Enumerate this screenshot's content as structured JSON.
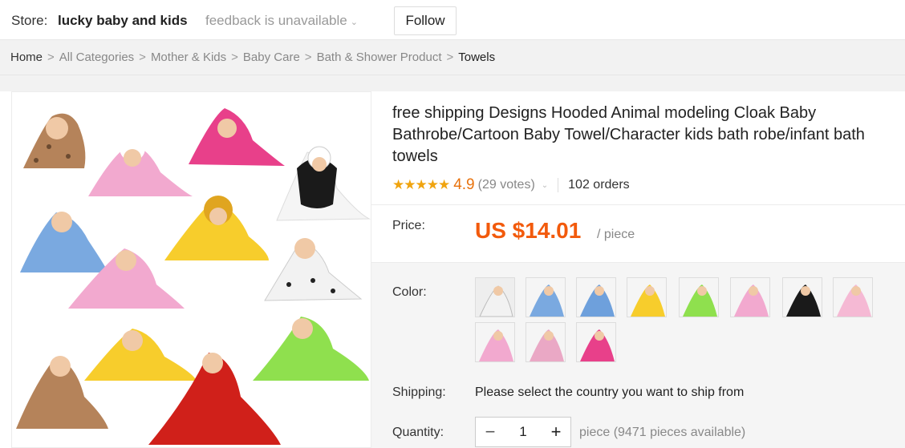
{
  "store": {
    "label": "Store:",
    "name": "lucky baby and kids",
    "feedback": "feedback is unavailable",
    "follow_label": "Follow"
  },
  "breadcrumb": {
    "items": [
      "Home",
      "All Categories",
      "Mother & Kids",
      "Baby Care",
      "Bath & Shower Product",
      "Towels"
    ],
    "separator": ">"
  },
  "product": {
    "title": "free shipping Designs Hooded Animal modeling Cloak Baby Bathrobe/Cartoon Baby Towel/Character kids bath robe/infant bath towels",
    "stars": "★★★★★",
    "rating": "4.9",
    "votes": "(29 votes)",
    "orders": "102 orders",
    "price_label": "Price:",
    "price": "US $14.01",
    "price_unit": "/ piece",
    "color_label": "Color:",
    "color_swatches": [
      "leopard-white",
      "blue-stitch",
      "blue-bunny",
      "yellow-lion",
      "green-frog",
      "pink-kitty",
      "panda-black",
      "pink-bunny",
      "pink-hello",
      "pink-stripe",
      "hot-pink-bear"
    ],
    "shipping_label": "Shipping:",
    "shipping_text": "Please select the country you want to ship from",
    "quantity_label": "Quantity:",
    "quantity_value": "1",
    "quantity_minus": "−",
    "quantity_plus": "+",
    "quantity_available": "piece (9471 pieces available)"
  },
  "colors": {
    "price": "#f25a0c",
    "rating": "#e8720c",
    "stars": "#f0a40f"
  }
}
